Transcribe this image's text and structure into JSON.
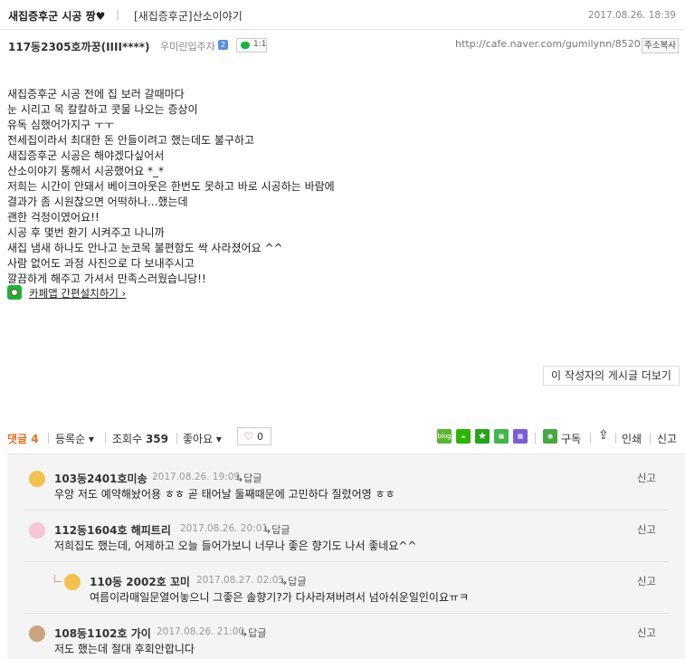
{
  "title_bar": {
    "title": "새집증후군 시공 짱♥",
    "separator": "|",
    "board": "[새집증후군]산소이야기",
    "date": "2017.08.26. 18:39"
  },
  "author_bar": {
    "author": "117동2305호까꿍(IIII****)",
    "level": "우미린입주자",
    "level_icon": "2",
    "chat_count": "1:1",
    "url": "http://cafe.naver.com/gumilynn/8520",
    "copy_label": "주소복사"
  },
  "body": {
    "lines": [
      "새집증후군 시공 전에 집 보러 갈때마다",
      "눈 시리고 목 칼칼하고 콧물 나오는 증상이",
      "유독 심했어가지구 ㅜㅜ",
      "전세집이라서 최대한 돈 안들이려고 했는데도 불구하고",
      "새집증후군 시공은 해야겠다싶어서",
      "산소이야기 통해서 시공했어요 *_*",
      "저희는 시간이 안돼서 베이크아웃은 한번도 못하고 바로 시공하는 바람에",
      "결과가 좀 시원찮으면 어떡하나...했는데",
      "괜한 걱정이였어요!!",
      "시공 후 몇번 환기 시켜주고 나니까",
      "새집 냄새 하나도 안나고 눈코목 불편함도 싹 사라졌어요 ^^",
      "사람 없어도 과정 사진으로 다 보내주시고",
      "깔끔하게 해주고 가셔서 만족스러웠습니당!!"
    ],
    "app_link": "카페앱 간편설치하기 ›"
  },
  "more_posts": "이 작성자의 게시글 더보기",
  "action_bar": {
    "comments_label": "댓글",
    "comments_count": "4",
    "sort_label": "등록순 ▾",
    "views_label": "조회수",
    "views_count": "359",
    "like_label": "좋아요 ▾",
    "like_count": "0",
    "subscribe": "구독",
    "print": "인쇄",
    "report": "신고",
    "share_icons": [
      "blog",
      "cafe",
      "bookmark",
      "memo",
      "calendar"
    ]
  },
  "comments": [
    {
      "name": "103동2401호미송",
      "date": "2017.08.26. 19:09",
      "reply": "답글",
      "report": "신고",
      "text": "우앙 저도 예약해놨어용 ㅎㅎ 곧 태어날 둘째때문에 고민하다 질렀어영 ㅎㅎ"
    },
    {
      "name": "112동1604호 해피트리",
      "date": "2017.08.26. 20:01",
      "reply": "답글",
      "report": "신고",
      "text": "저희집도 했는데, 어제하고 오늘 들어가보니 너무나 좋은 향기도 나서 좋네요^^"
    },
    {
      "name": "110동 2002호 꼬미",
      "date": "2017.08.27. 02:05",
      "reply": "답글",
      "report": "신고",
      "text": "여름이라매일문열어놓으니 그좋은 솔향기?가 다사라져버려서 넘아쉬운일인이요ㅠㅋ"
    },
    {
      "name": "108동1102호 가이",
      "date": "2017.08.26. 21:00",
      "reply": "답글",
      "report": "신고",
      "text": "저도 했는데 절대 후회안합니다"
    }
  ],
  "colors": {
    "accent_orange": "#e86e1e",
    "naver_green": "#1cb33a",
    "heart_red": "#e54040"
  }
}
